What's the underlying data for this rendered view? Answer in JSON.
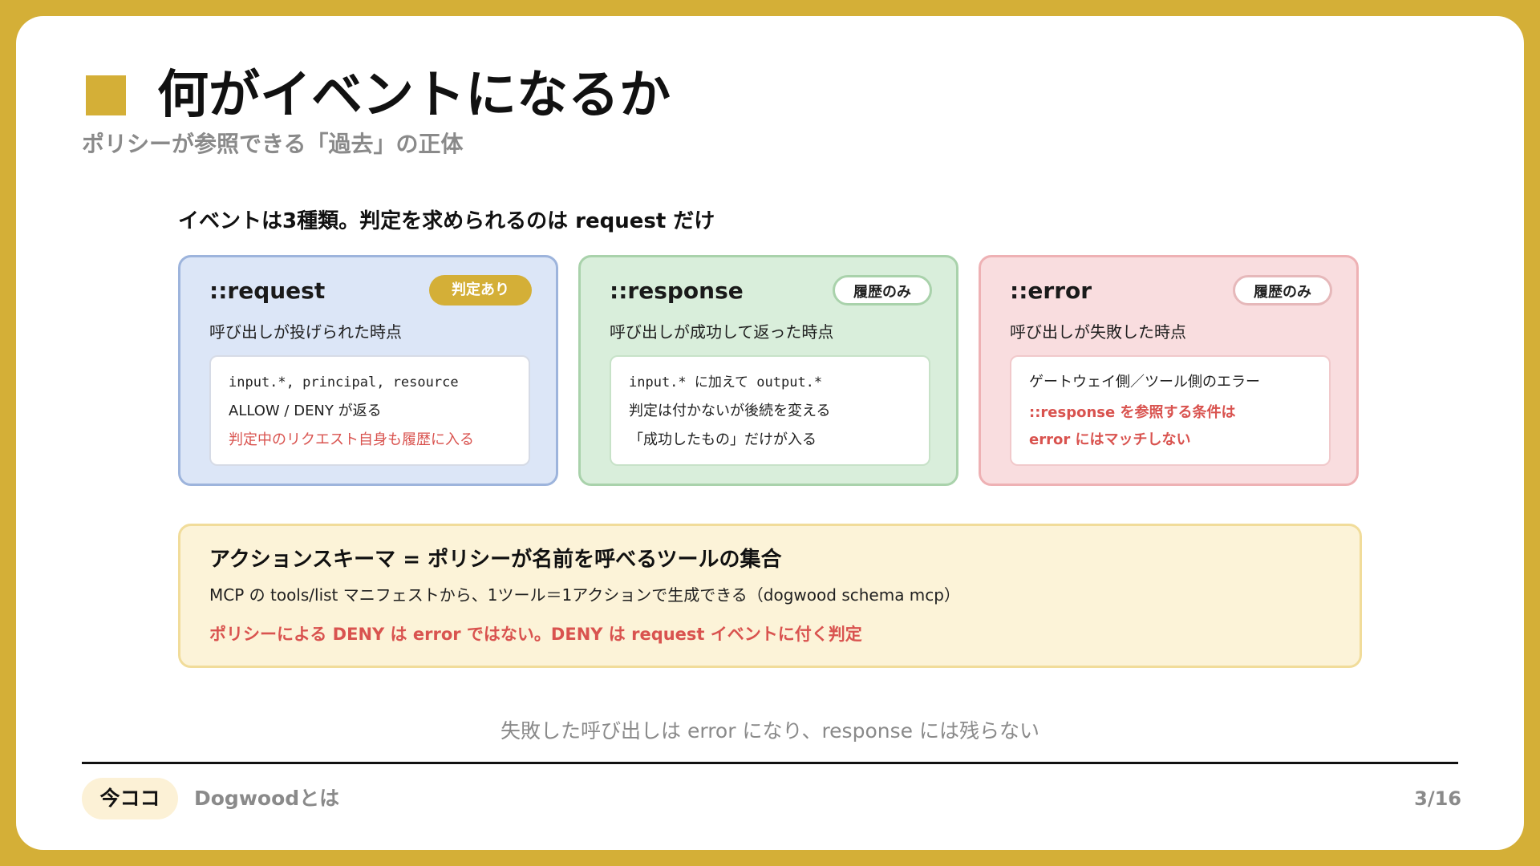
{
  "header": {
    "title": "何がイベントになるか",
    "subtitle": "ポリシーが参照できる「過去」の正体"
  },
  "lead": "イベントは3種類。判定を求められるのは request だけ",
  "cards": [
    {
      "title": "::request",
      "badge": "判定あり",
      "desc": "呼び出しが投げられた時点",
      "lines": [
        "input.*, principal, resource",
        "ALLOW / DENY が返る",
        "判定中のリクエスト自身も履歴に入る"
      ]
    },
    {
      "title": "::response",
      "badge": "履歴のみ",
      "desc": "呼び出しが成功して返った時点",
      "lines": [
        "input.* に加えて output.*",
        "判定は付かないが後続を変える",
        "「成功したもの」だけが入る"
      ]
    },
    {
      "title": "::error",
      "badge": "履歴のみ",
      "desc": "呼び出しが失敗した時点",
      "lines": [
        "ゲートウェイ側／ツール側のエラー",
        "::response を参照する条件は",
        "error にはマッチしない"
      ]
    }
  ],
  "schema": {
    "title": "アクションスキーマ = ポリシーが名前を呼べるツールの集合",
    "text": "MCP の tools/list マニフェストから、1ツール＝1アクションで生成できる（dogwood schema mcp）",
    "note": "ポリシーによる DENY は error ではない。DENY は request イベントに付く判定"
  },
  "footnote": "失敗した呼び出しは error になり、response には残らない",
  "footer": {
    "current": "今ココ",
    "section": "Dogwoodとは",
    "page": "3/16"
  },
  "colors": {
    "accent": "#d4af37",
    "request_bg": "#dce6f7",
    "response_bg": "#d9eedb",
    "error_bg": "#f9dddf",
    "schema_bg": "#fcf3d8",
    "warning": "#d9534f"
  }
}
